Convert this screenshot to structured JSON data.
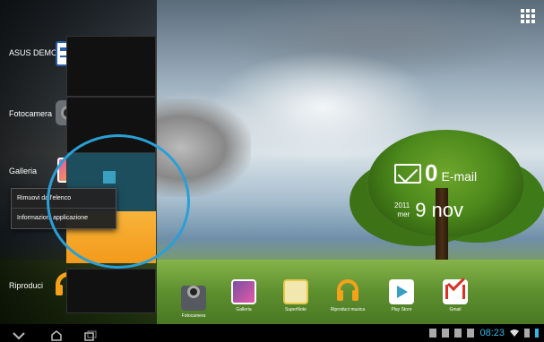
{
  "recents": {
    "items": [
      {
        "label": "ASUS DEMO",
        "icon": "asus-demo-icon"
      },
      {
        "label": "Fotocamera",
        "icon": "camera-icon"
      },
      {
        "label": "Galleria",
        "icon": "gallery-icon"
      },
      {
        "label": "Riproduci",
        "icon": "headphones-icon"
      }
    ],
    "context_menu": {
      "remove": "Rimuovi dall'elenco",
      "info": "Informazioni applicazione"
    }
  },
  "widgets": {
    "email_count": "0",
    "email_label": "E-mail",
    "year": "2011",
    "weekday": "mer",
    "date": "9 nov"
  },
  "dock": {
    "apps": [
      {
        "label": "Fotocamera",
        "icon": "camera-icon",
        "color": "#555a60"
      },
      {
        "label": "Galleria",
        "icon": "gallery-icon",
        "color": "#7b4fa2"
      },
      {
        "label": "SuperNote",
        "icon": "supernote-icon",
        "color": "#e6c84a"
      },
      {
        "label": "Riproduci musica",
        "icon": "headphones-icon",
        "color": "#f5a21b"
      },
      {
        "label": "Play Store",
        "icon": "play-store-icon",
        "color": "#ffffff"
      },
      {
        "label": "Gmail",
        "icon": "gmail-icon",
        "color": "#d93025"
      }
    ]
  },
  "statusbar": {
    "time": "08:23"
  },
  "colors": {
    "highlight": "#2a9fd6",
    "clock": "#33b5e5"
  }
}
